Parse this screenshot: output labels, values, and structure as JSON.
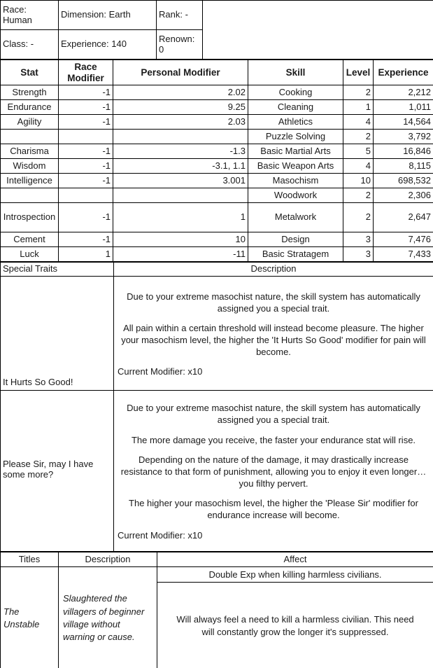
{
  "info": {
    "race": "Race: Human",
    "dimension": "Dimension: Earth",
    "rank": "Rank: -",
    "class": "Class: -",
    "experience": "Experience: 140",
    "renown": "Renown: 0"
  },
  "stats_table": {
    "headers": {
      "stat": "Stat",
      "race_modifier": "Race Modifier",
      "personal_modifier": "Personal Modifier",
      "skill": "Skill",
      "level": "Level",
      "experience": "Experience"
    },
    "rows": [
      {
        "stat": "Strength",
        "race_mod": "-1",
        "personal_mod": "2.02",
        "skill": "Cooking",
        "level": "2",
        "exp": "2,212"
      },
      {
        "stat": "Endurance",
        "race_mod": "-1",
        "personal_mod": "9.25",
        "skill": "Cleaning",
        "level": "1",
        "exp": "1,011"
      },
      {
        "stat": "Agility",
        "race_mod": "-1",
        "personal_mod": "2.03",
        "skill": "Athletics",
        "level": "4",
        "exp": "14,564"
      },
      {
        "stat": "",
        "race_mod": "",
        "personal_mod": "",
        "skill": "Puzzle Solving",
        "level": "2",
        "exp": "3,792"
      },
      {
        "stat": "Charisma",
        "race_mod": "-1",
        "personal_mod": "-1.3",
        "skill": "Basic Martial Arts",
        "level": "5",
        "exp": "16,846"
      },
      {
        "stat": "Wisdom",
        "race_mod": "-1",
        "personal_mod": "-3.1, 1.1",
        "skill": "Basic Weapon Arts",
        "level": "4",
        "exp": "8,115"
      },
      {
        "stat": "Intelligence",
        "race_mod": "-1",
        "personal_mod": "3.001",
        "skill": "Masochism",
        "level": "10",
        "exp": "698,532"
      },
      {
        "stat": "",
        "race_mod": "",
        "personal_mod": "",
        "skill": "Woodwork",
        "level": "2",
        "exp": "2,306"
      },
      {
        "stat": "Introspection",
        "race_mod": "-1",
        "personal_mod": "1",
        "skill": "Metalwork",
        "level": "2",
        "exp": "2,647"
      },
      {
        "stat": "Cement",
        "race_mod": "-1",
        "personal_mod": "10",
        "skill": "Design",
        "level": "3",
        "exp": "7,476"
      },
      {
        "stat": "Luck",
        "race_mod": "1",
        "personal_mod": "-11",
        "skill": "Basic Stratagem",
        "level": "3",
        "exp": "7,433"
      }
    ]
  },
  "special_traits": {
    "headers": {
      "name": "Special Traits",
      "description": "Description"
    },
    "items": [
      {
        "name": "It Hurts So Good!",
        "paragraphs": [
          "Due to your extreme masochist nature, the skill system has automatically assigned you a special trait.",
          "All pain within a certain threshold will instead become pleasure. The higher your masochism level, the higher the 'It Hurts So Good' modifier for pain will become."
        ],
        "current_modifier": "Current Modifier: x10"
      },
      {
        "name": "Please Sir, may I have some more?",
        "paragraphs": [
          "Due to your extreme masochist nature, the skill system has automatically assigned you a special trait.",
          "The more damage you receive, the faster your endurance stat will rise.",
          "Depending on the nature of the damage, it may drastically increase resistance to that form of punishment, allowing you to enjoy it even longer… you filthy pervert.",
          "The higher your masochism level, the higher the 'Please Sir' modifier for endurance increase will become."
        ],
        "current_modifier": "Current Modifier: x10"
      }
    ]
  },
  "titles": {
    "headers": {
      "title": "Titles",
      "description": "Description",
      "affect": "Affect"
    },
    "rows": [
      {
        "title": "The Unstable",
        "description": "Slaughtered the villagers of beginner village without warning or cause.",
        "affects": [
          "Double Exp when killing harmless civilians.",
          "Will always feel a need to kill a harmless civilian. This need will constantly grow the longer it's suppressed."
        ]
      }
    ]
  },
  "colors": {
    "border": "#000000",
    "text": "#1a1a1a",
    "background": "#ffffff"
  }
}
